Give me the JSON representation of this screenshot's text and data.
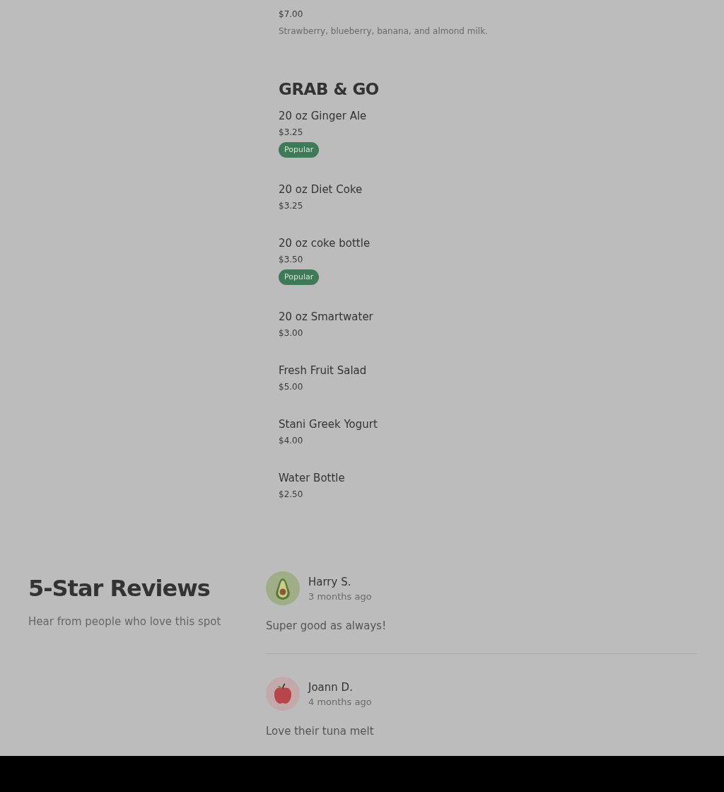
{
  "menu": {
    "top_item": {
      "price": "$7.00",
      "description": "Strawberry, blueberry, banana, and almond milk."
    },
    "section": {
      "title": "GRAB & GO",
      "items": [
        {
          "name": "20 oz Ginger Ale",
          "price": "$3.25",
          "badge": "Popular"
        },
        {
          "name": "20 oz Diet Coke",
          "price": "$3.25"
        },
        {
          "name": "20 oz coke bottle",
          "price": "$3.50",
          "badge": "Popular"
        },
        {
          "name": "20 oz Smartwater",
          "price": "$3.00"
        },
        {
          "name": "Fresh Fruit Salad",
          "price": "$5.00"
        },
        {
          "name": "Stani Greek Yogurt",
          "price": "$4.00"
        },
        {
          "name": "Water Bottle",
          "price": "$2.50"
        }
      ]
    }
  },
  "reviews": {
    "title": "5-Star Reviews",
    "subtitle": "Hear from people who love this spot",
    "items": [
      {
        "name": "Harry S.",
        "time": "3 months ago",
        "text": "Super good as always!",
        "kind": "avocado"
      },
      {
        "name": "Joann D.",
        "time": "4 months ago",
        "text": "Love their tuna melt",
        "kind": "apple"
      }
    ]
  }
}
